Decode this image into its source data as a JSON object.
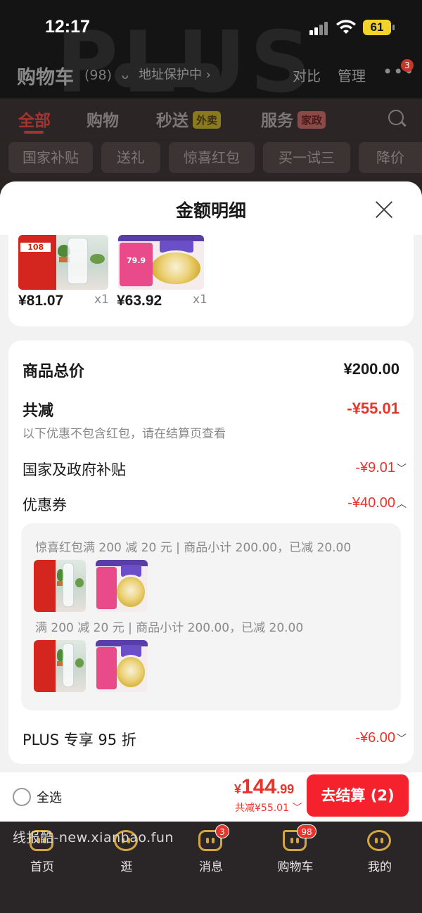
{
  "status_bar": {
    "time": "12:17",
    "battery": "61"
  },
  "header": {
    "title": "购物车",
    "count": "(98)",
    "address_pill": "地址保护中",
    "compare": "对比",
    "manage": "管理",
    "more_badge": "3",
    "watermark_text": "PLUS"
  },
  "category_tabs": [
    {
      "label": "全部"
    },
    {
      "label": "购物"
    },
    {
      "label": "秒送",
      "tag": "外卖"
    },
    {
      "label": "服务",
      "tag": "家政"
    }
  ],
  "filter_chips": [
    "国家补贴",
    "送礼",
    "惊喜红包",
    "买一试三",
    "降价"
  ],
  "sheet": {
    "title": "金额明细",
    "items": [
      {
        "price": "¥81.07",
        "qty": "x1",
        "image_badge": "108"
      },
      {
        "price": "¥63.92",
        "qty": "x1",
        "image_badge": "79.9"
      }
    ],
    "summary": {
      "goods_total_label": "商品总价",
      "goods_total_value": "¥200.00",
      "discount_label": "共减",
      "discount_value": "-¥55.01",
      "discount_note": "以下优惠不包含红包，请在结算页查看",
      "subsidy_label": "国家及政府补贴",
      "subsidy_value": "-¥9.01",
      "coupon_label": "优惠券",
      "coupon_value": "-¥40.00",
      "coupon_groups": [
        {
          "text": "惊喜红包满 200 减 20 元 | 商品小计 200.00，已减 20.00"
        },
        {
          "text": "满 200 减 20 元 | 商品小计 200.00，已减 20.00"
        }
      ],
      "plus_label": "PLUS 专享 95 折",
      "plus_value": "-¥6.00"
    }
  },
  "checkout": {
    "select_all": "全选",
    "currency": "¥",
    "price_int": "144",
    "price_dec": ".99",
    "saved": "共减¥55.01",
    "button": "去结算 (2)"
  },
  "watermark": "线报酷-new.xianbao.fun",
  "tabbar": [
    {
      "label": "首页",
      "icon": "home-icon"
    },
    {
      "label": "逛",
      "icon": "browse-icon"
    },
    {
      "label": "消息",
      "icon": "message-icon",
      "badge": "3"
    },
    {
      "label": "购物车",
      "icon": "cart-icon",
      "badge": "98"
    },
    {
      "label": "我的",
      "icon": "profile-icon"
    }
  ],
  "colors": {
    "accent_red": "#f5222d",
    "price_red": "#e8352b",
    "tab_gold": "#d4a640"
  }
}
